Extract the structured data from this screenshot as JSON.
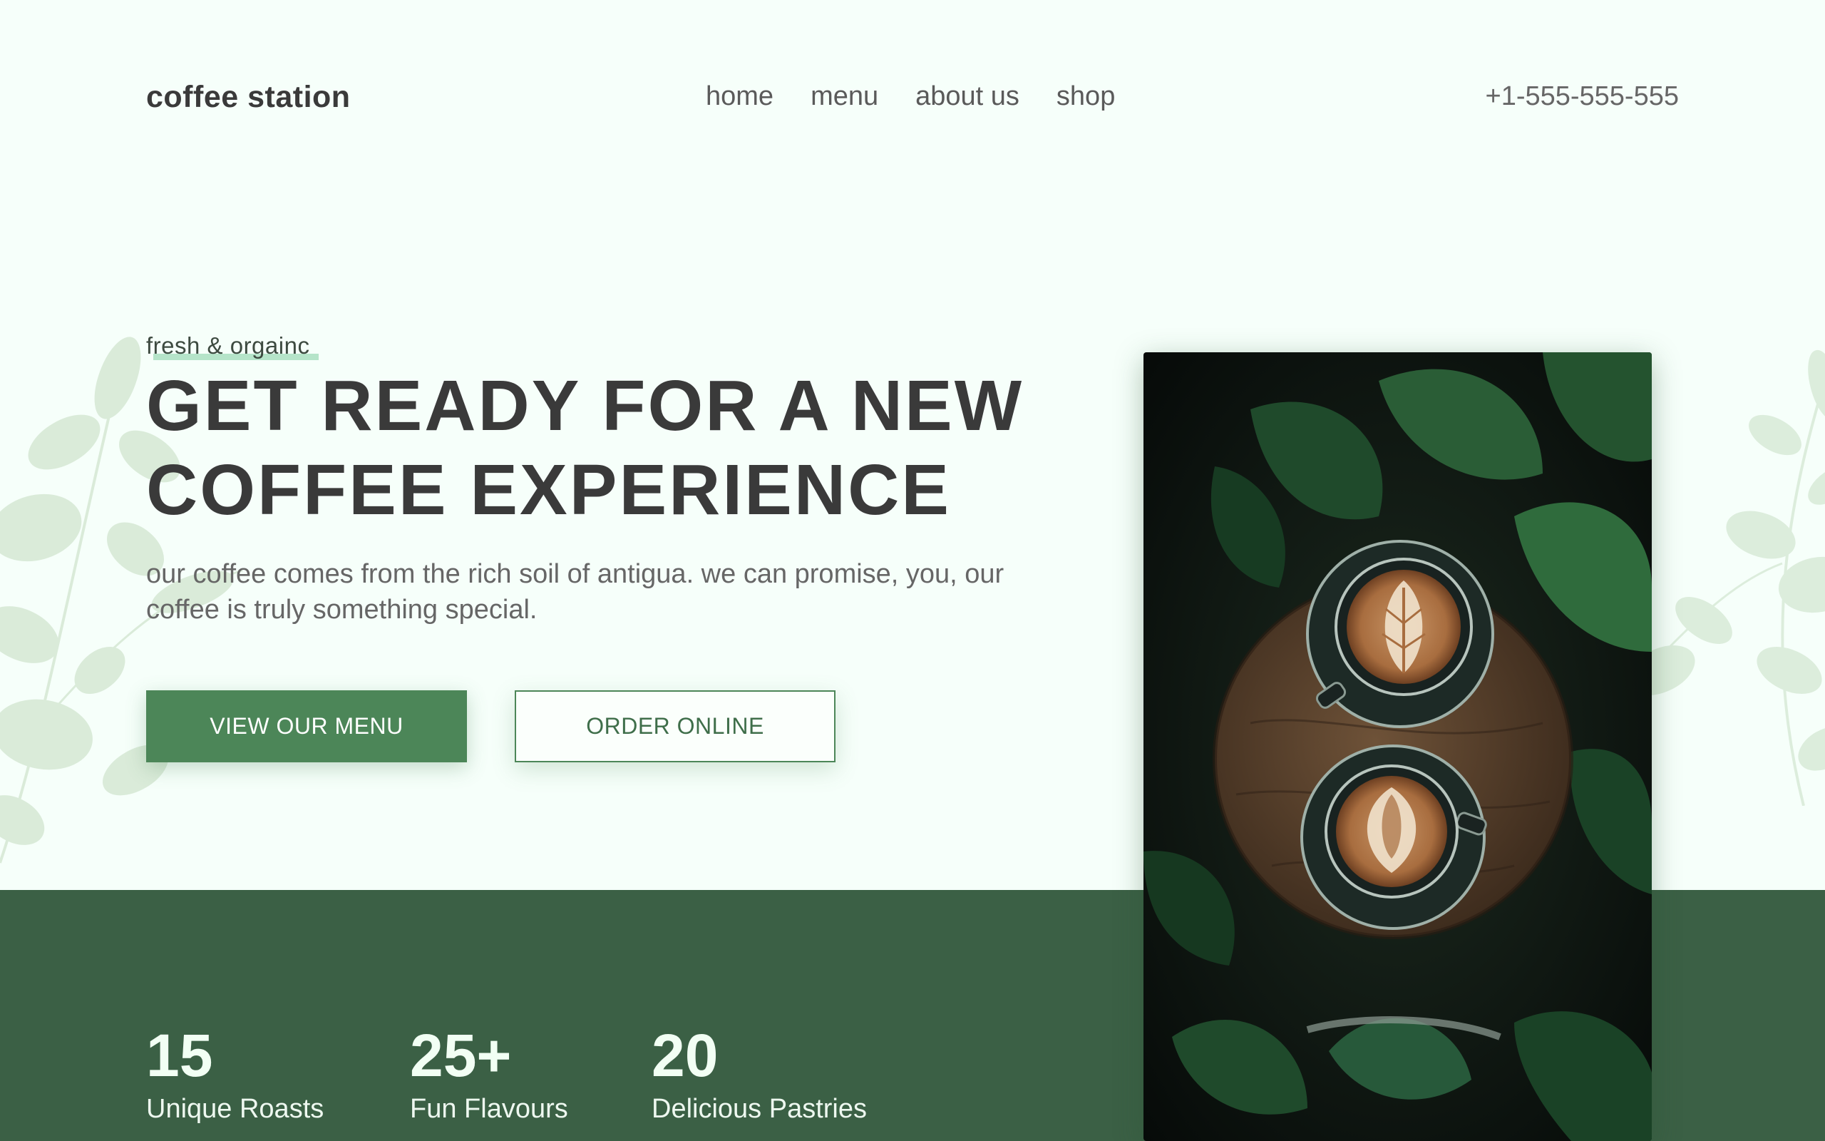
{
  "header": {
    "brand": "coffee station",
    "nav": [
      {
        "label": "home"
      },
      {
        "label": "menu"
      },
      {
        "label": "about us"
      },
      {
        "label": "shop"
      }
    ],
    "phone": "+1-555-555-555"
  },
  "hero": {
    "eyebrow": "fresh & orgainc",
    "headline_line1": "GET READY FOR A NEW",
    "headline_line2": "COFFEE EXPERIENCE",
    "intro_line1": "our coffee comes from the rich soil of antigua. we can promise, you, our",
    "intro_line2": "coffee is truly something special.",
    "primary_button": "VIEW OUR MENU",
    "secondary_button": "ORDER ONLINE"
  },
  "stats": [
    {
      "number": "15",
      "label": "Unique Roasts"
    },
    {
      "number": "25+",
      "label": "Fun Flavours"
    },
    {
      "number": "20",
      "label": "Delicious Pastries"
    }
  ],
  "colors": {
    "background": "#f6fffa",
    "accent_green": "#4c8658",
    "band_green": "#3b6045",
    "underline_mint": "#a9dfbf",
    "heading_text": "#3a3a3a"
  },
  "images": {
    "hero_photo": "latte-cups-on-wooden-stool-among-plants",
    "decor_left": "eucalyptus-leaves-icon",
    "decor_right": "eucalyptus-leaves-icon"
  }
}
